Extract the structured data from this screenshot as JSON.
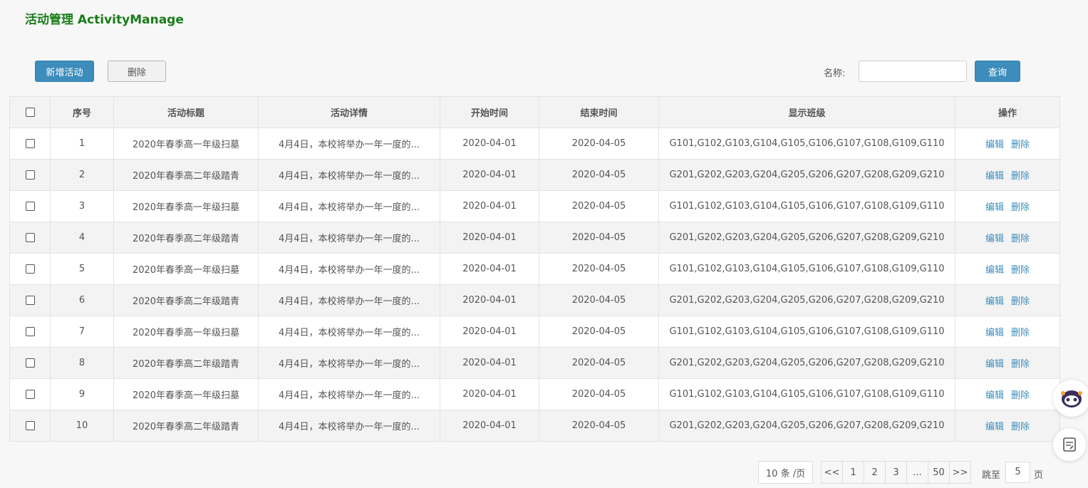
{
  "page": {
    "title": "活动管理 ActivityManage"
  },
  "toolbar": {
    "add_label": "新增活动",
    "delete_label": "删除",
    "search_label": "名称:",
    "search_value": "",
    "query_label": "查询"
  },
  "table": {
    "headers": [
      "序号",
      "活动标题",
      "活动详情",
      "开始时间",
      "结束时间",
      "显示班级",
      "操作"
    ],
    "edit_label": "编辑",
    "delete_label": "删除",
    "rows": [
      {
        "no": "1",
        "title": "2020年春季高一年级扫墓",
        "detail": "4月4日，本校将举办一年一度的...",
        "start": "2020-04-01",
        "end": "2020-04-05",
        "classes": "G101,G102,G103,G104,G105,G106,G107,G108,G109,G110"
      },
      {
        "no": "2",
        "title": "2020年春季高二年级踏青",
        "detail": "4月4日，本校将举办一年一度的...",
        "start": "2020-04-01",
        "end": "2020-04-05",
        "classes": "G201,G202,G203,G204,G205,G206,G207,G208,G209,G210"
      },
      {
        "no": "3",
        "title": "2020年春季高一年级扫墓",
        "detail": "4月4日，本校将举办一年一度的...",
        "start": "2020-04-01",
        "end": "2020-04-05",
        "classes": "G101,G102,G103,G104,G105,G106,G107,G108,G109,G110"
      },
      {
        "no": "4",
        "title": "2020年春季高二年级踏青",
        "detail": "4月4日，本校将举办一年一度的...",
        "start": "2020-04-01",
        "end": "2020-04-05",
        "classes": "G201,G202,G203,G204,G205,G206,G207,G208,G209,G210"
      },
      {
        "no": "5",
        "title": "2020年春季高一年级扫墓",
        "detail": "4月4日，本校将举办一年一度的...",
        "start": "2020-04-01",
        "end": "2020-04-05",
        "classes": "G101,G102,G103,G104,G105,G106,G107,G108,G109,G110"
      },
      {
        "no": "6",
        "title": "2020年春季高二年级踏青",
        "detail": "4月4日，本校将举办一年一度的...",
        "start": "2020-04-01",
        "end": "2020-04-05",
        "classes": "G201,G202,G203,G204,G205,G206,G207,G208,G209,G210"
      },
      {
        "no": "7",
        "title": "2020年春季高一年级扫墓",
        "detail": "4月4日，本校将举办一年一度的...",
        "start": "2020-04-01",
        "end": "2020-04-05",
        "classes": "G101,G102,G103,G104,G105,G106,G107,G108,G109,G110"
      },
      {
        "no": "8",
        "title": "2020年春季高二年级踏青",
        "detail": "4月4日，本校将举办一年一度的...",
        "start": "2020-04-01",
        "end": "2020-04-05",
        "classes": "G201,G202,G203,G204,G205,G206,G207,G208,G209,G210"
      },
      {
        "no": "9",
        "title": "2020年春季高一年级扫墓",
        "detail": "4月4日，本校将举办一年一度的...",
        "start": "2020-04-01",
        "end": "2020-04-05",
        "classes": "G101,G102,G103,G104,G105,G106,G107,G108,G109,G110"
      },
      {
        "no": "10",
        "title": "2020年春季高二年级踏青",
        "detail": "4月4日，本校将举办一年一度的...",
        "start": "2020-04-01",
        "end": "2020-04-05",
        "classes": "G201,G202,G203,G204,G205,G206,G207,G208,G209,G210"
      }
    ]
  },
  "pagination": {
    "page_size_label": "10 条 /页",
    "buttons": [
      "<<",
      "1",
      "2",
      "3",
      "...",
      "50",
      ">>"
    ],
    "jump_label": "跳至",
    "jump_value": "5",
    "jump_suffix": "页"
  },
  "icons": {
    "assistant": "robot-icon",
    "notes": "notepad-icon"
  },
  "colors": {
    "primary": "#3c8dbc",
    "title": "#1a7c1a"
  }
}
